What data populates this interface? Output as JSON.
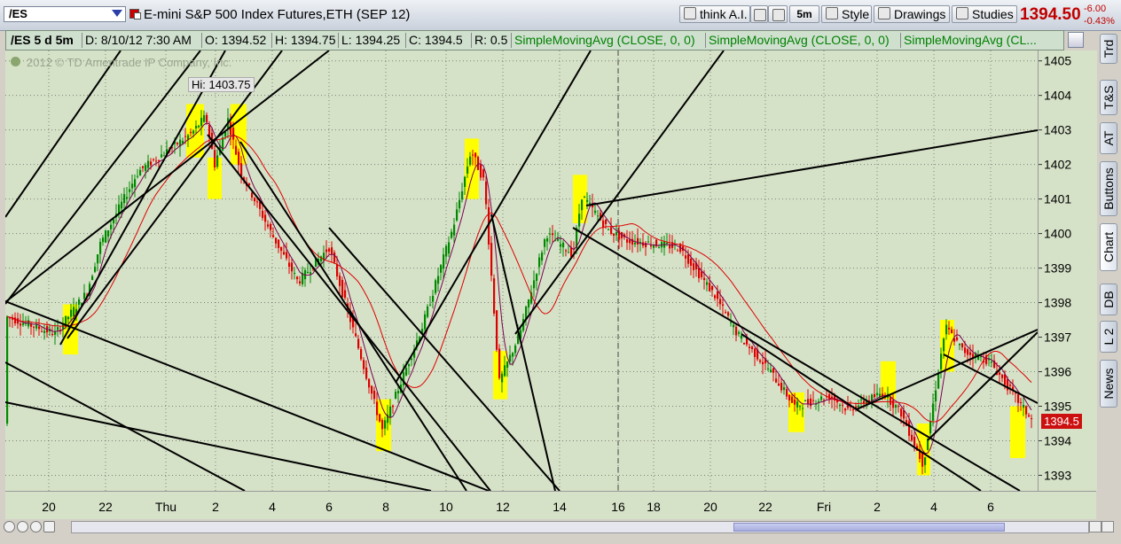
{
  "toolbar": {
    "symbol": "/ES",
    "instrument": "E-mini S&P 500 Index Futures,ETH (SEP 12)",
    "think_label": "think A.I.",
    "timeframe": "5m",
    "style_label": "Style",
    "drawings_label": "Drawings",
    "studies_label": "Studies",
    "last_price": "1394.50",
    "change": "-6.00",
    "change_pct": "-0.43%"
  },
  "stats": {
    "period": "/ES 5 d 5m",
    "date": "D: 8/10/12 7:30 AM",
    "open": "O: 1394.52",
    "high": "H: 1394.75",
    "low": "L: 1394.25",
    "close": "C: 1394.5",
    "range": "R: 0.5",
    "study1": "SimpleMovingAvg (CLOSE, 0, 0)",
    "study2": "SimpleMovingAvg (CLOSE, 0, 0)",
    "study3": "SimpleMovingAvg (CL..."
  },
  "side_tabs": [
    "Trd",
    "T&S",
    "AT",
    "Buttons",
    "Chart",
    "DB",
    "L 2",
    "News"
  ],
  "chart_data": {
    "type": "candlestick",
    "watermark": "2012 © TD Ameritrade IP Company, Inc.",
    "hi_label": "Hi: 1403.75",
    "price_marker": "1394.5",
    "y_ticks": [
      1405,
      1404,
      1403,
      1402,
      1401,
      1400,
      1399,
      1398,
      1397,
      1396,
      1395,
      1394,
      1393
    ],
    "ylim": [
      1392.55,
      1405.3
    ],
    "x_ticks": [
      "20",
      "22",
      "Thu",
      "2",
      "4",
      "6",
      "8",
      "10",
      "12",
      "14",
      "16",
      "18",
      "20",
      "22",
      "Fri",
      "2",
      "4",
      "6"
    ],
    "up_color": "#008800",
    "down_color": "#dd0000",
    "highlight_color": "#ffff00",
    "sma_fast_color": "#7a0050",
    "sma_slow_color": "#dd0000",
    "price_path": [
      [
        "20",
        1397.6
      ],
      [
        "21",
        1397.1
      ],
      [
        "22",
        1398.3
      ],
      [
        "22.5",
        1399.7
      ],
      [
        "Thu",
        1401.8
      ],
      [
        "1",
        1402.9
      ],
      [
        "1.5",
        1403.4
      ],
      [
        "2",
        1402.0
      ],
      [
        "2.5",
        1403.3
      ],
      [
        "3",
        1401.8
      ],
      [
        "4",
        1400.0
      ],
      [
        "5",
        1398.6
      ],
      [
        "6",
        1399.6
      ],
      [
        "7",
        1397.4
      ],
      [
        "8",
        1394.3
      ],
      [
        "9",
        1397.3
      ],
      [
        "10",
        1400.2
      ],
      [
        "11",
        1402.4
      ],
      [
        "11.5",
        1401.5
      ],
      [
        "12",
        1395.7
      ],
      [
        "12.5",
        1397.1
      ],
      [
        "13",
        1400.0
      ],
      [
        "14",
        1399.4
      ],
      [
        "15",
        1401.1
      ],
      [
        "16",
        1400.1
      ],
      [
        "17",
        1399.8
      ],
      [
        "19",
        1399.6
      ],
      [
        "20",
        1398.2
      ],
      [
        "21",
        1397.1
      ],
      [
        "22",
        1396.1
      ],
      [
        "23",
        1395.0
      ],
      [
        "Fri",
        1395.3
      ],
      [
        "1",
        1394.9
      ],
      [
        "2",
        1395.4
      ],
      [
        "3",
        1394.8
      ],
      [
        "4",
        1393.3
      ],
      [
        "4.5",
        1397.3
      ],
      [
        "5",
        1396.6
      ],
      [
        "6",
        1396.3
      ],
      [
        "7",
        1394.5
      ]
    ]
  }
}
